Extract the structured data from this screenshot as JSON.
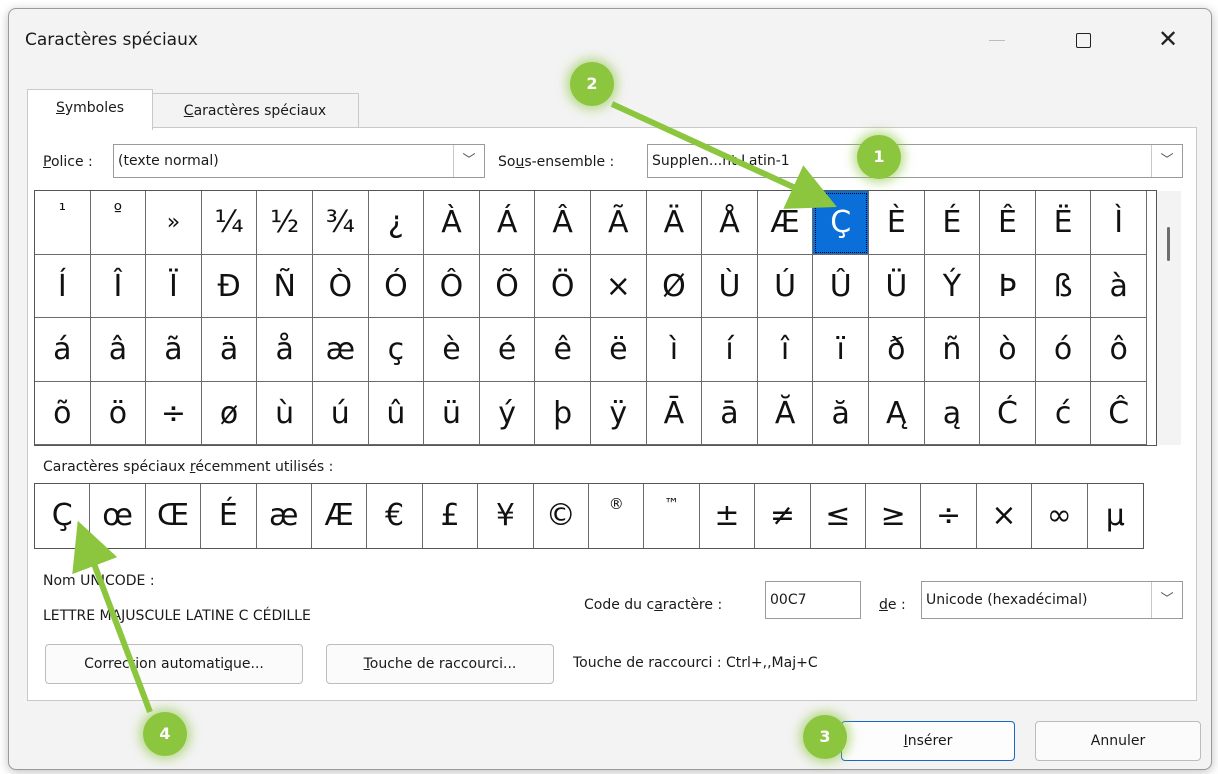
{
  "window": {
    "title": "Caractères spéciaux",
    "min_label": "—",
    "close_label": "✕"
  },
  "tabs": [
    {
      "pre": "",
      "key": "S",
      "post": "ymboles",
      "active": true
    },
    {
      "pre": "",
      "key": "C",
      "post": "aractères spéciaux",
      "active": false
    }
  ],
  "font": {
    "label_key": "P",
    "label_rest": "olice :",
    "value": "(texte normal)"
  },
  "subset": {
    "label_pre": "So",
    "label_key": "u",
    "label_post": "s-ensemble :",
    "value": "Supplen...nt Latin-1"
  },
  "symbol_grid": {
    "rows": [
      [
        "¹",
        "º",
        "»",
        "¼",
        "½",
        "¾",
        "¿",
        "À",
        "Á",
        "Â",
        "Ã",
        "Ä",
        "Å",
        "Æ",
        "Ç",
        "È",
        "É",
        "Ê",
        "Ë",
        "Ì"
      ],
      [
        "Í",
        "Î",
        "Ï",
        "Ð",
        "Ñ",
        "Ò",
        "Ó",
        "Ô",
        "Õ",
        "Ö",
        "×",
        "Ø",
        "Ù",
        "Ú",
        "Û",
        "Ü",
        "Ý",
        "Þ",
        "ß",
        "à"
      ],
      [
        "á",
        "â",
        "ã",
        "ä",
        "å",
        "æ",
        "ç",
        "è",
        "é",
        "ê",
        "ë",
        "ì",
        "í",
        "î",
        "ï",
        "ð",
        "ñ",
        "ò",
        "ó",
        "ô"
      ],
      [
        "õ",
        "ö",
        "÷",
        "ø",
        "ù",
        "ú",
        "û",
        "ü",
        "ý",
        "þ",
        "ÿ",
        "Ā",
        "ā",
        "Ă",
        "ă",
        "Ą",
        "ą",
        "Ć",
        "ć",
        "Ĉ"
      ]
    ],
    "selected_row": 0,
    "selected_col": 14
  },
  "recent": {
    "label_pre": "Caractères spéciaux ",
    "label_key": "r",
    "label_post": "écemment utilisés :",
    "chars": [
      "Ç",
      "œ",
      "Œ",
      "É",
      "æ",
      "Æ",
      "€",
      "£",
      "¥",
      "©",
      "®",
      "™",
      "±",
      "≠",
      "≤",
      "≥",
      "÷",
      "×",
      "∞",
      "µ"
    ]
  },
  "unicode": {
    "name_label": "Nom UNICODE :",
    "name_value": "LETTRE MAJUSCULE LATINE C CÉDILLE"
  },
  "char_code": {
    "label_pre": "Code du c",
    "label_key": "a",
    "label_post": "ractère :",
    "value": "00C7",
    "from_key": "d",
    "from_post": "e :",
    "from_value": "Unicode (hexadécimal)"
  },
  "buttons": {
    "autocorrect_pre": "Correction automati",
    "autocorrect_key": "q",
    "autocorrect_post": "ue...",
    "shortcut_key": "T",
    "shortcut_post": "ouche de raccourci...",
    "shortcut_info": "Touche de raccourci : Ctrl+,,Maj+C",
    "insert_key": "I",
    "insert_post": "nsérer",
    "cancel": "Annuler"
  },
  "callouts": [
    "1",
    "2",
    "3",
    "4"
  ],
  "colors": {
    "selection": "#0a6fd8",
    "badge": "#8cc63f"
  }
}
